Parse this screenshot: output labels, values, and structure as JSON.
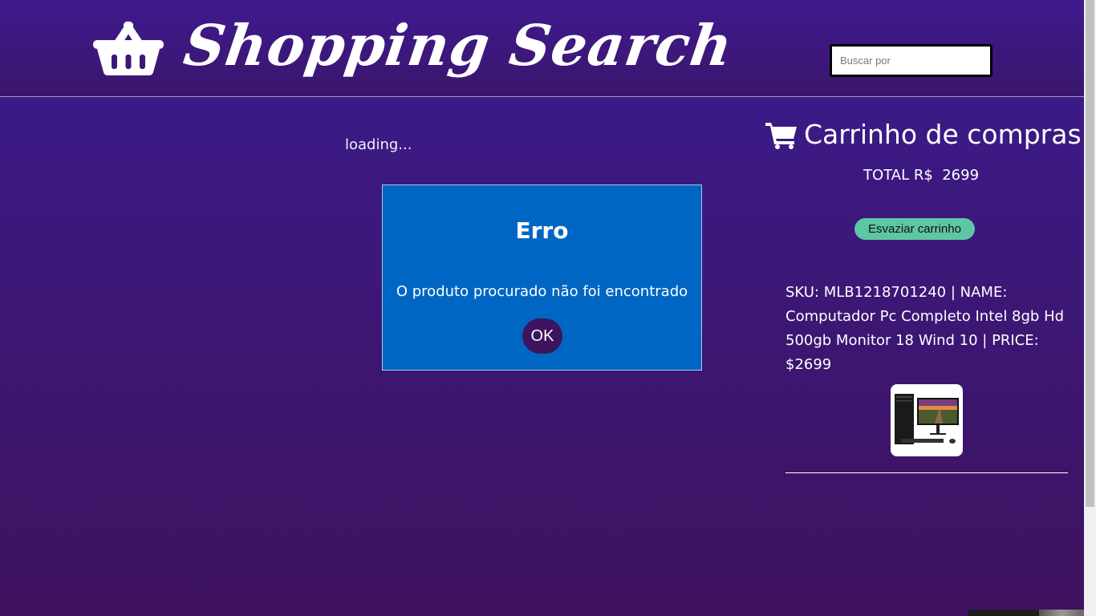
{
  "header": {
    "title": "Shopping Search",
    "logo_icon": "shopping-basket-icon",
    "search_placeholder": "Buscar por"
  },
  "main": {
    "loading_text": "loading..."
  },
  "modal": {
    "title": "Erro",
    "message": "O produto procurado não foi encontrado",
    "ok_label": "OK"
  },
  "cart": {
    "icon": "shopping-cart-icon",
    "title": "Carrinho de compras",
    "total_text": "TOTAL R$  2699",
    "empty_label": "Esvaziar carrinho",
    "items": [
      {
        "text": "SKU: MLB1218701240 | NAME: Computador Pc Completo Intel 8gb Hd 500gb Monitor 18 Wind 10 | PRICE: $2699",
        "image": "desktop-computer-thumbnail"
      }
    ]
  },
  "colors": {
    "background": "#3c1670",
    "modal_background": "#0066c4",
    "ok_button": "#3d145e",
    "empty_button": "#5ec6a4"
  }
}
